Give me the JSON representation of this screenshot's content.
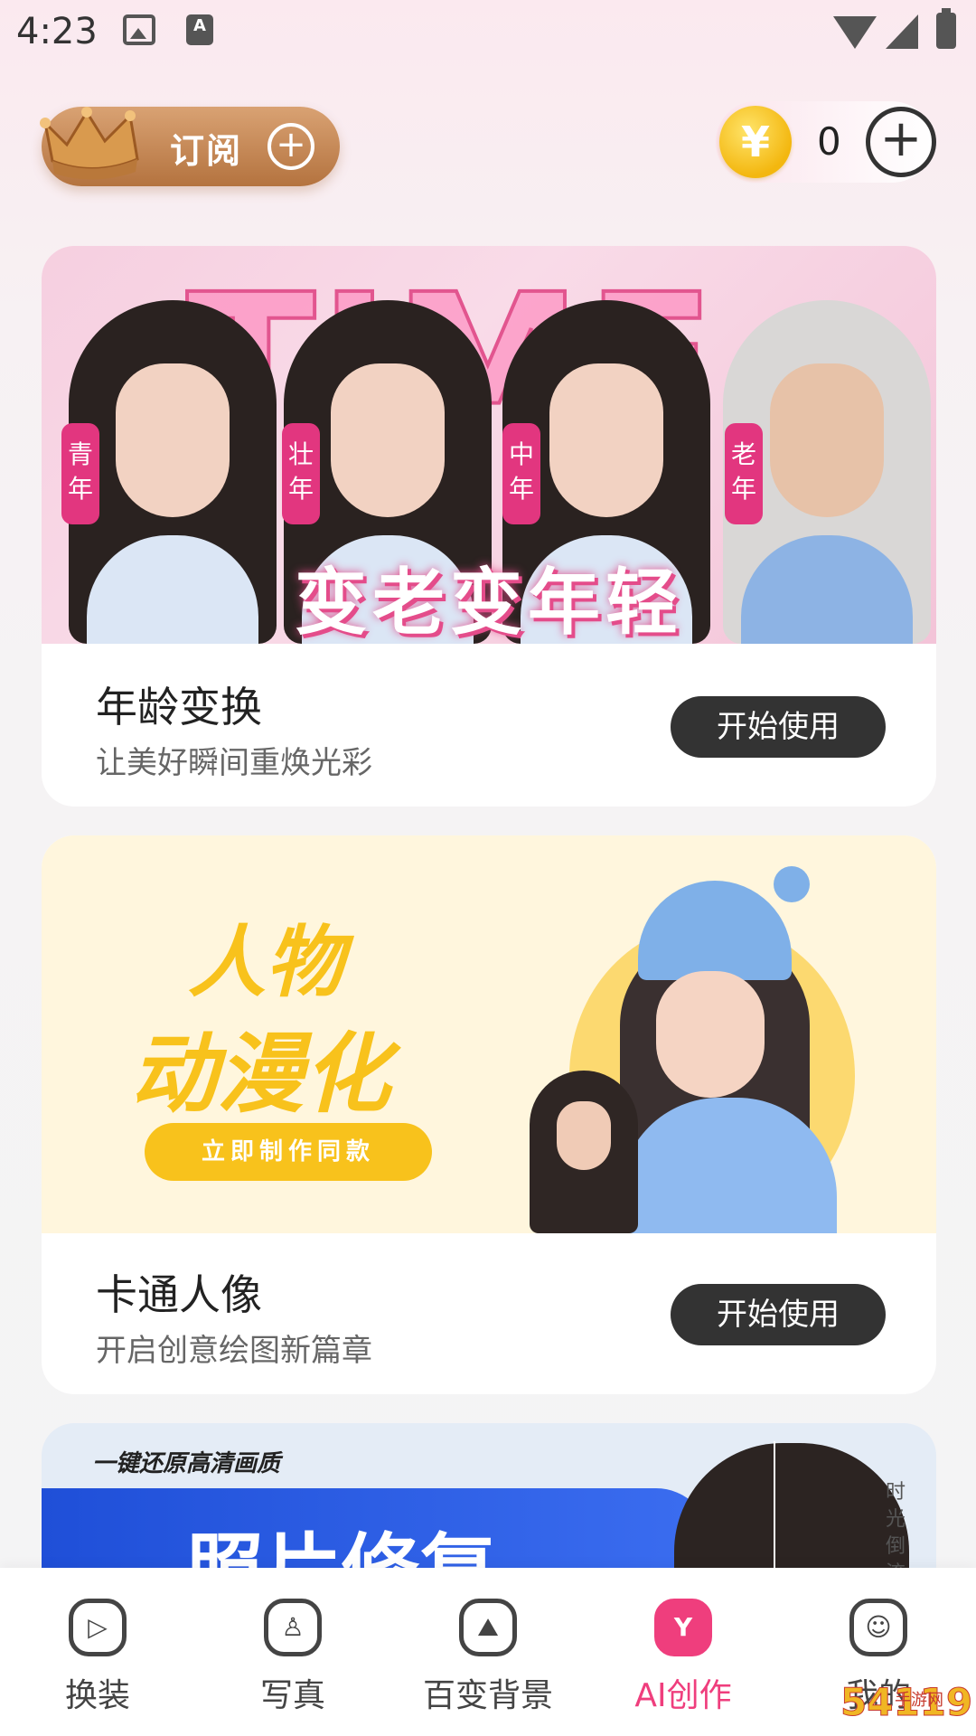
{
  "status_bar": {
    "time": "4:23",
    "a_badge": "A"
  },
  "header": {
    "subscribe_label": "订阅",
    "subscribe_plus": "+",
    "coin_symbol": "¥",
    "coin_count": "0",
    "coin_plus": "+"
  },
  "cards": [
    {
      "banner_word": "TIME",
      "age_tags": [
        "青\n年",
        "壮\n年",
        "中\n年",
        "老\n年"
      ],
      "banner_slogan": "变老变年轻",
      "title": "年龄变换",
      "subtitle": "让美好瞬间重焕光彩",
      "button": "开始使用"
    },
    {
      "banner_line1": "人物",
      "banner_line2": "动漫化",
      "banner_cta": "立即制作同款",
      "title": "卡通人像",
      "subtitle": "开启创意绘图新篇章",
      "button": "开始使用"
    },
    {
      "banner_caption": "一键还原高清画质",
      "banner_big": "照片修复",
      "side_text": "时光倒流"
    }
  ],
  "bottom_nav": {
    "items": [
      {
        "label": "换装",
        "glyph": "▷"
      },
      {
        "label": "写真",
        "glyph": "♙"
      },
      {
        "label": "百变背景",
        "glyph": "⛰"
      },
      {
        "label": "AI创作",
        "glyph": "Y"
      },
      {
        "label": "我的",
        "glyph": "☺"
      }
    ],
    "active_index": 3,
    "active_color": "#ef3e7d"
  },
  "watermark": {
    "text": "54119",
    "sub": "手游网"
  }
}
